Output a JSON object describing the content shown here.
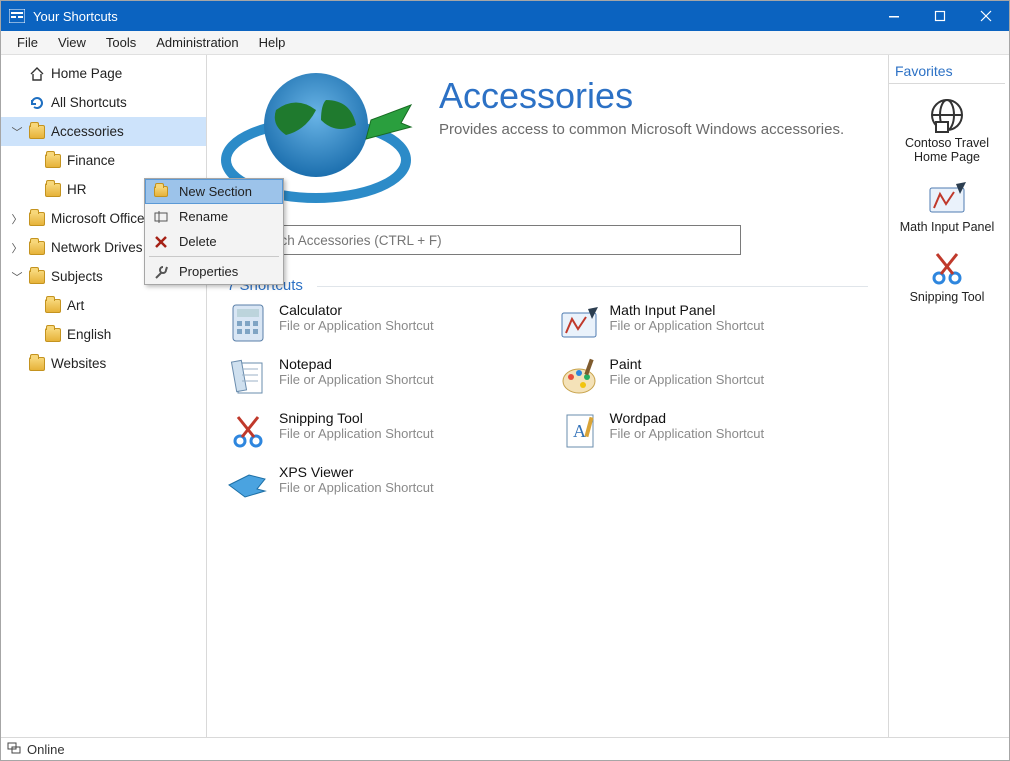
{
  "window": {
    "title": "Your Shortcuts"
  },
  "menubar": [
    "File",
    "View",
    "Tools",
    "Administration",
    "Help"
  ],
  "sidebar": {
    "items": [
      {
        "label": "Home Page",
        "icon": "home",
        "expander": ""
      },
      {
        "label": "All Shortcuts",
        "icon": "refresh",
        "expander": ""
      },
      {
        "label": "Accessories",
        "icon": "folder",
        "expander": "down",
        "selected": true
      },
      {
        "label": "Finance",
        "icon": "folder",
        "child": true
      },
      {
        "label": "HR",
        "icon": "folder",
        "child": true
      },
      {
        "label": "Microsoft Office",
        "icon": "folder",
        "expander": "right"
      },
      {
        "label": "Network Drives",
        "icon": "folder",
        "expander": "right"
      },
      {
        "label": "Subjects",
        "icon": "folder",
        "expander": "down"
      },
      {
        "label": "Art",
        "icon": "folder",
        "child": true
      },
      {
        "label": "English",
        "icon": "folder",
        "child": true
      },
      {
        "label": "Websites",
        "icon": "folder",
        "expander": ""
      }
    ]
  },
  "context_menu": {
    "items": [
      {
        "label": "New Section",
        "icon": "new-folder",
        "selected": true
      },
      {
        "label": "Rename",
        "icon": "rename"
      },
      {
        "label": "Delete",
        "icon": "delete"
      },
      {
        "sep": true
      },
      {
        "label": "Properties",
        "icon": "wrench"
      }
    ]
  },
  "page": {
    "title": "Accessories",
    "subtitle": "Provides access to common Microsoft Windows accessories.",
    "search_placeholder": "Search Accessories (CTRL + F)",
    "section_label": "7 Shortcuts"
  },
  "shortcuts": [
    {
      "title": "Calculator",
      "sub": "File or Application Shortcut",
      "icon": "calculator"
    },
    {
      "title": "Math Input Panel",
      "sub": "File or Application Shortcut",
      "icon": "math"
    },
    {
      "title": "Notepad",
      "sub": "File or Application Shortcut",
      "icon": "notepad"
    },
    {
      "title": "Paint",
      "sub": "File or Application Shortcut",
      "icon": "paint"
    },
    {
      "title": "Snipping Tool",
      "sub": "File or Application Shortcut",
      "icon": "snip"
    },
    {
      "title": "Wordpad",
      "sub": "File or Application Shortcut",
      "icon": "wordpad"
    },
    {
      "title": "XPS Viewer",
      "sub": "File or Application Shortcut",
      "icon": "xps"
    }
  ],
  "favorites": {
    "header": "Favorites",
    "items": [
      {
        "title": "Contoso Travel Home Page",
        "icon": "globe"
      },
      {
        "title": "Math Input Panel",
        "icon": "math"
      },
      {
        "title": "Snipping Tool",
        "icon": "snip"
      }
    ]
  },
  "statusbar": {
    "text": "Online"
  }
}
